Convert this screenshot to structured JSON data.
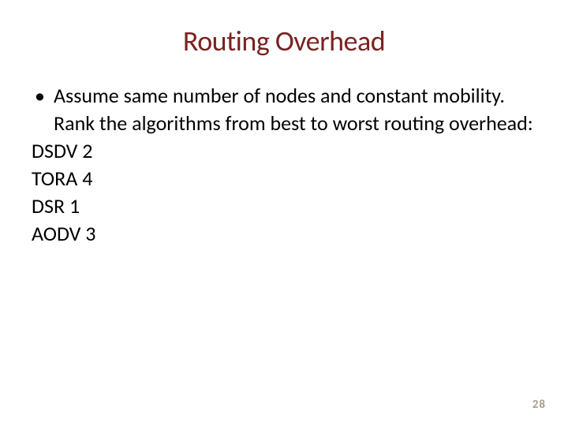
{
  "title": "Routing Overhead",
  "bullet_text": "Assume same number of nodes and constant mobility. Rank the algorithms from best to worst routing overhead:",
  "lines": {
    "l1": "DSDV 2",
    "l2": "TORA 4",
    "l3": "DSR 1",
    "l4": "AODV 3"
  },
  "page_number": "28"
}
